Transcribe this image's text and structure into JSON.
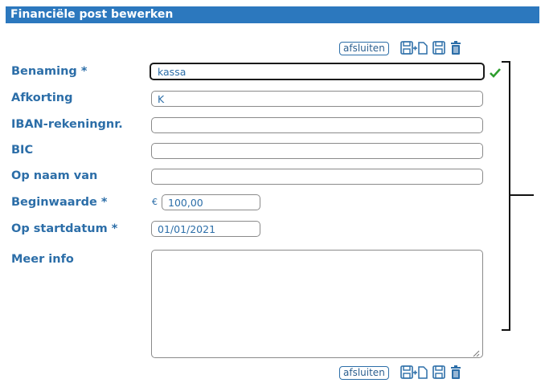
{
  "title": "Financiële post bewerken",
  "toolbar": {
    "close_label": "afsluiten",
    "icons": [
      "save-new-icon",
      "save-icon",
      "trash-icon"
    ]
  },
  "fields": {
    "benaming": {
      "label": "Benaming *",
      "value": "kassa"
    },
    "afkorting": {
      "label": "Afkorting",
      "value": "K"
    },
    "iban": {
      "label": "IBAN-rekeningnr.",
      "value": ""
    },
    "bic": {
      "label": "BIC",
      "value": ""
    },
    "op_naam_van": {
      "label": "Op naam van",
      "value": ""
    },
    "beginwaarde": {
      "label": "Beginwaarde *",
      "currency": "€",
      "value": "100,00"
    },
    "op_startdatum": {
      "label": "Op startdatum *",
      "value": "01/01/2021"
    },
    "meer_info": {
      "label": "Meer info",
      "value": ""
    }
  },
  "colors": {
    "accent": "#2c78be",
    "label": "#2c6ea8",
    "valid": "#2e9e2e"
  }
}
